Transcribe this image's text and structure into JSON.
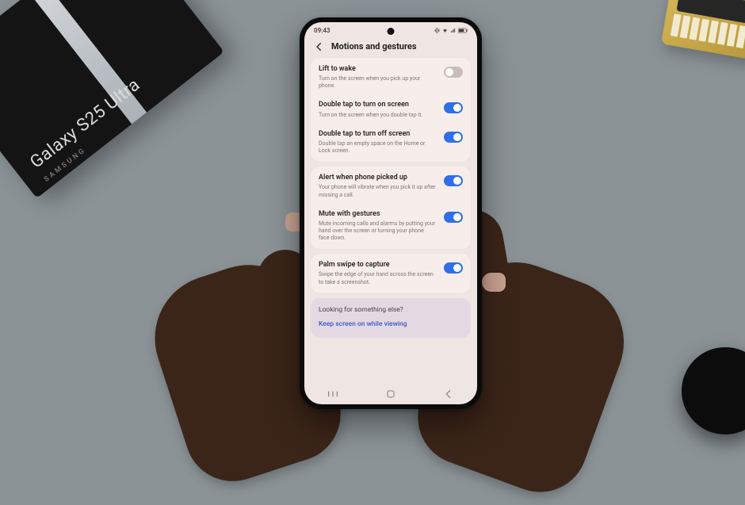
{
  "box": {
    "product": "Galaxy S25 Ultra",
    "brand": "SAMSUNG"
  },
  "statusbar": {
    "time": "09:43"
  },
  "header": {
    "title": "Motions and gestures"
  },
  "groups": [
    {
      "items": [
        {
          "title": "Lift to wake",
          "sub": "Turn on the screen when you pick up your phone.",
          "on": false
        },
        {
          "title": "Double tap to turn on screen",
          "sub": "Turn on the screen when you double tap it.",
          "on": true
        },
        {
          "title": "Double tap to turn off screen",
          "sub": "Double tap an empty space on the Home or Lock screen.",
          "on": true
        }
      ]
    },
    {
      "items": [
        {
          "title": "Alert when phone picked up",
          "sub": "Your phone will vibrate when you pick it up after missing a call.",
          "on": true
        },
        {
          "title": "Mute with gestures",
          "sub": "Mute incoming calls and alarms by putting your hand over the screen or turning your phone face down.",
          "on": true
        }
      ]
    },
    {
      "items": [
        {
          "title": "Palm swipe to capture",
          "sub": "Swipe the edge of your hand across the screen to take a screenshot.",
          "on": true
        }
      ]
    }
  ],
  "footer": {
    "prompt": "Looking for something else?",
    "link": "Keep screen on while viewing"
  }
}
